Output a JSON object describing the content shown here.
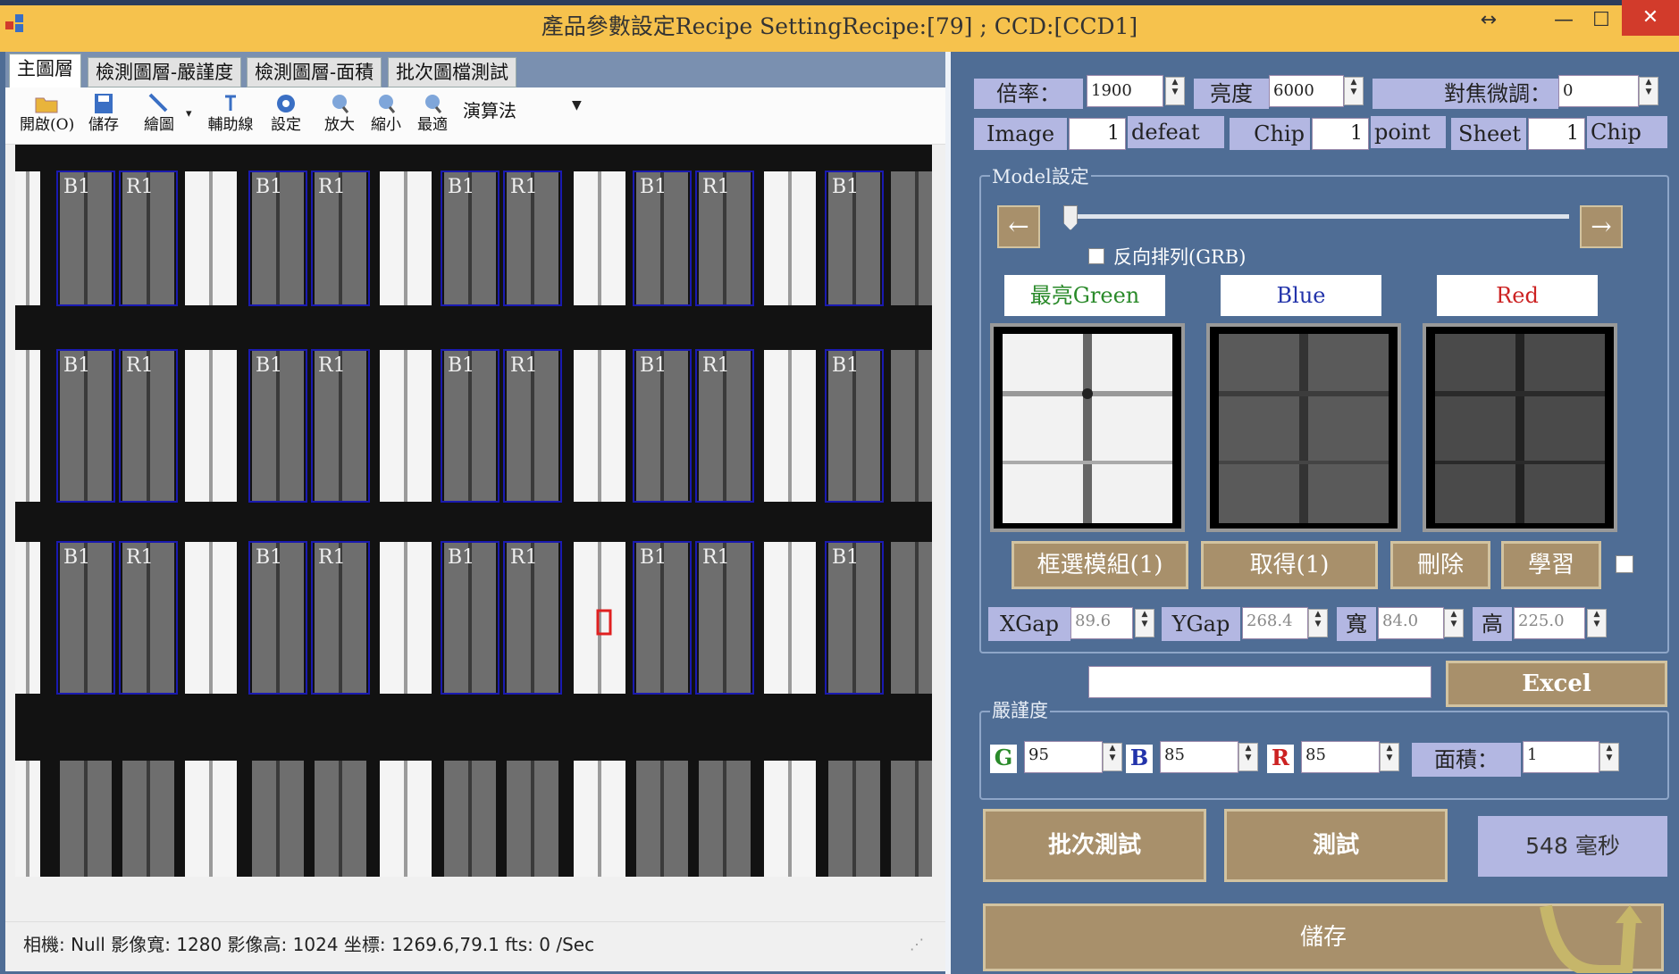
{
  "window": {
    "title": "產品參數設定Recipe SettingRecipe:[79] ; CCD:[CCD1]",
    "buttons": {
      "restore": "↔",
      "minimize": "—",
      "maximize": "☐",
      "close": "✕"
    }
  },
  "tabs": [
    {
      "label": "主圖層",
      "active": true
    },
    {
      "label": "檢測圖層-嚴謹度",
      "active": false
    },
    {
      "label": "檢測圖層-面積",
      "active": false
    },
    {
      "label": "批次圖檔測試",
      "active": false
    }
  ],
  "toolbar": {
    "tools": [
      {
        "label": "開啟(O)",
        "icon": "folder-open-icon"
      },
      {
        "label": "儲存",
        "icon": "save-icon"
      },
      {
        "label": "繪圖",
        "icon": "draw-icon"
      },
      {
        "label": "輔助線",
        "icon": "guide-line-icon"
      },
      {
        "label": "設定",
        "icon": "settings-icon"
      },
      {
        "label": "放大",
        "icon": "zoom-in-icon"
      },
      {
        "label": "縮小",
        "icon": "zoom-out-icon"
      },
      {
        "label": "最適",
        "icon": "zoom-fit-icon"
      }
    ],
    "algorithm_label": "演算法"
  },
  "image": {
    "grid_labels": [
      "B1",
      "R1",
      "B1",
      "R1",
      "B1",
      "R1",
      "B1",
      "R1",
      "B1"
    ]
  },
  "status": {
    "text": "相機:  Null  影像寬:  1280  影像高:  1024  坐標:  1269.6,79.1  fts:  0  /Sec"
  },
  "right": {
    "zoom_label": "倍率：",
    "zoom_value": "1900",
    "brightness_label": "亮度",
    "brightness_value": "6000",
    "focus_label": "對焦微調：",
    "focus_value": "0",
    "image_label": "Image",
    "image_value": "1",
    "defeat_label": "defeat",
    "chip_label": "Chip",
    "chip_value": "1",
    "point_label": "point",
    "sheet_label": "Sheet",
    "sheet_value": "1",
    "chip2_label": "Chip",
    "model_group": "Model設定",
    "prev_arrow": "←",
    "next_arrow": "→",
    "reverse_label": "反向排列(GRB)",
    "swatch_green": "最亮Green",
    "swatch_blue": "Blue",
    "swatch_red": "Red",
    "btn_select_module": "框選模組(1)",
    "btn_get": "取得(1)",
    "btn_delete": "刪除",
    "btn_learn": "學習",
    "xgap_label": "XGap",
    "xgap_value": "89.6",
    "ygap_label": "YGap",
    "ygap_value": "268.4",
    "width_label": "寬",
    "width_value": "84.0",
    "height_label": "高",
    "height_value": "225.0",
    "excel_button": "Excel",
    "strict_group": "嚴謹度",
    "g_label": "G",
    "g_value": "95",
    "b_label": "B",
    "b_value": "85",
    "r_label": "R",
    "r_value": "85",
    "area_label": "面積：",
    "area_value": "1",
    "btn_batch_test": "批次測試",
    "btn_test": "測試",
    "elapsed": "548 毫秒",
    "btn_save": "儲存"
  },
  "colors": {
    "accent": "#f6c24d",
    "panel": "#4f6d95",
    "button_brown": "#a8906b",
    "label_lavender": "#b3b7e2"
  }
}
